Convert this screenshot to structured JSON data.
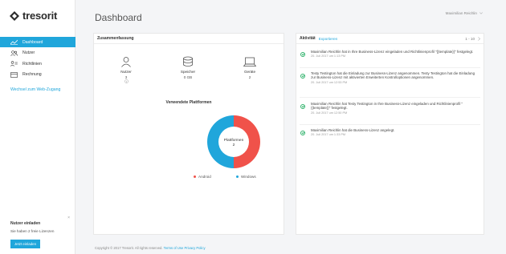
{
  "brand": {
    "name": "tresorit"
  },
  "sidebar": {
    "items": [
      {
        "label": "Dashboard",
        "icon": "chart-icon",
        "active": true
      },
      {
        "label": "Nutzer",
        "icon": "users-icon",
        "active": false
      },
      {
        "label": "Richtlinien",
        "icon": "policy-icon",
        "active": false
      },
      {
        "label": "Rechnung",
        "icon": "invoice-icon",
        "active": false
      }
    ],
    "web_link": "Wechsel zum Web-Zugang",
    "invite": {
      "title": "Nutzer einladen",
      "subtitle": "Sie haben 2 freie Lizenzen",
      "button": "Jetzt einladen",
      "close": "×"
    }
  },
  "header": {
    "title": "Dashboard",
    "user": "Maximilian Reichlin"
  },
  "summary": {
    "title": "Zusammenfassung",
    "stats": [
      {
        "label": "Nutzer",
        "value": "3",
        "icon": "user-icon"
      },
      {
        "label": "Speicher",
        "value": "0 GB",
        "icon": "storage-icon"
      },
      {
        "label": "Geräte",
        "value": "2",
        "icon": "laptop-icon"
      }
    ],
    "platforms_title": "Verwendete Plattformen",
    "donut_label": "Plattformen",
    "donut_value": "2",
    "legend": [
      {
        "name": "Android",
        "color": "#f0524a"
      },
      {
        "name": "Windows",
        "color": "#20a6db"
      }
    ],
    "share_android": 0.5
  },
  "activity": {
    "title": "Aktivität",
    "export": "Exportieren",
    "count": "1 - 10",
    "items": [
      {
        "text": "Maximilian Reichlin hat in Ihre Business-Lizenz eingeladen und Richtlinienprofil \"{{template}}\" festgelegt.",
        "time": "20. Juli 2017 um 1:13 PM"
      },
      {
        "text": "Testy Testington hat die Einladung zur Business-Lizenz angenommen. Testy Testington hat die Einladung zur Business-Lizenz mit aktivierten Erweiterten Kontrolloptionen angenommen.",
        "time": "20. Juli 2017 um 12:53 PM"
      },
      {
        "text": "Maximilian Reichlin hat Testy Testington in Ihre Business-Lizenz eingeladen und Richtlinienprofil \"{{template}}\" festgelegt.",
        "time": "20. Juli 2017 um 12:50 PM"
      },
      {
        "text": "Maximilian Reichlin hat die Business-Lizenz angelegt.",
        "time": "20. Juli 2017 um 1:33 PM"
      }
    ]
  },
  "footer": {
    "copyright": "Copyright © 2017 Tresorit. All rights reserved.",
    "terms": "Terms of Use",
    "privacy": "Privacy Policy"
  },
  "colors": {
    "accent": "#20a6db",
    "android": "#f0524a",
    "success": "#32b36d"
  }
}
